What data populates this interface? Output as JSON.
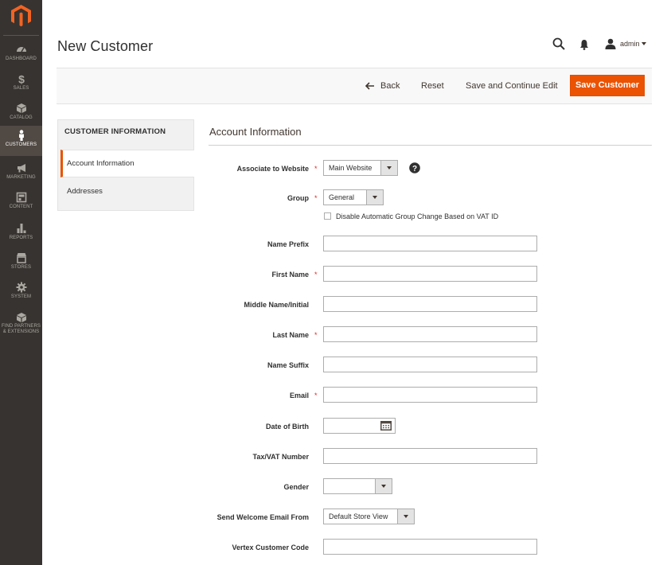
{
  "colors": {
    "sidebar_bg": "#373330",
    "sidebar_active_bg": "#514943",
    "accent": "#eb5202",
    "required": "#e22626"
  },
  "sidebar": {
    "logo_icon": "magento-logo-icon",
    "items": [
      {
        "label": "DASHBOARD",
        "icon": "dashboard-icon",
        "active": false
      },
      {
        "label": "SALES",
        "icon": "dollar-icon",
        "active": false
      },
      {
        "label": "CATALOG",
        "icon": "cube-icon",
        "active": false
      },
      {
        "label": "CUSTOMERS",
        "icon": "person-icon",
        "active": true
      },
      {
        "label": "MARKETING",
        "icon": "megaphone-icon",
        "active": false
      },
      {
        "label": "CONTENT",
        "icon": "layout-icon",
        "active": false
      },
      {
        "label": "REPORTS",
        "icon": "bar-chart-icon",
        "active": false
      },
      {
        "label": "STORES",
        "icon": "store-icon",
        "active": false
      },
      {
        "label": "SYSTEM",
        "icon": "gear-icon",
        "active": false
      },
      {
        "label_line1": "FIND PARTNERS",
        "label_line2": "& EXTENSIONS",
        "icon": "box-icon",
        "active": false
      }
    ]
  },
  "header": {
    "title": "New Customer",
    "user_name": "admin",
    "icons": [
      "search-icon",
      "bell-icon",
      "user-icon",
      "chevron-down-icon"
    ]
  },
  "actions": {
    "back_label": "Back",
    "reset_label": "Reset",
    "save_continue_label": "Save and Continue Edit",
    "save_label": "Save Customer"
  },
  "tabs": {
    "title": "CUSTOMER INFORMATION",
    "items": [
      {
        "label": "Account Information",
        "active": true
      },
      {
        "label": "Addresses",
        "active": false
      }
    ]
  },
  "form": {
    "section_title": "Account Information",
    "associate_website": {
      "label": "Associate to Website",
      "required": true,
      "value": "Main Website"
    },
    "group": {
      "label": "Group",
      "required": true,
      "value": "General"
    },
    "disable_group_change": {
      "label": "Disable Automatic Group Change Based on VAT ID",
      "checked": false
    },
    "name_prefix": {
      "label": "Name Prefix",
      "required": false,
      "value": ""
    },
    "first_name": {
      "label": "First Name",
      "required": true,
      "value": ""
    },
    "middle_name": {
      "label": "Middle Name/Initial",
      "required": false,
      "value": ""
    },
    "last_name": {
      "label": "Last Name",
      "required": true,
      "value": ""
    },
    "name_suffix": {
      "label": "Name Suffix",
      "required": false,
      "value": ""
    },
    "email": {
      "label": "Email",
      "required": true,
      "value": ""
    },
    "dob": {
      "label": "Date of Birth",
      "required": false,
      "value": ""
    },
    "tax_vat": {
      "label": "Tax/VAT Number",
      "required": false,
      "value": ""
    },
    "gender": {
      "label": "Gender",
      "required": false,
      "value": ""
    },
    "welcome_email": {
      "label": "Send Welcome Email From",
      "required": false,
      "value": "Default Store View"
    },
    "vertex_code": {
      "label": "Vertex Customer Code",
      "required": false,
      "value": ""
    },
    "required_mark": "*"
  }
}
